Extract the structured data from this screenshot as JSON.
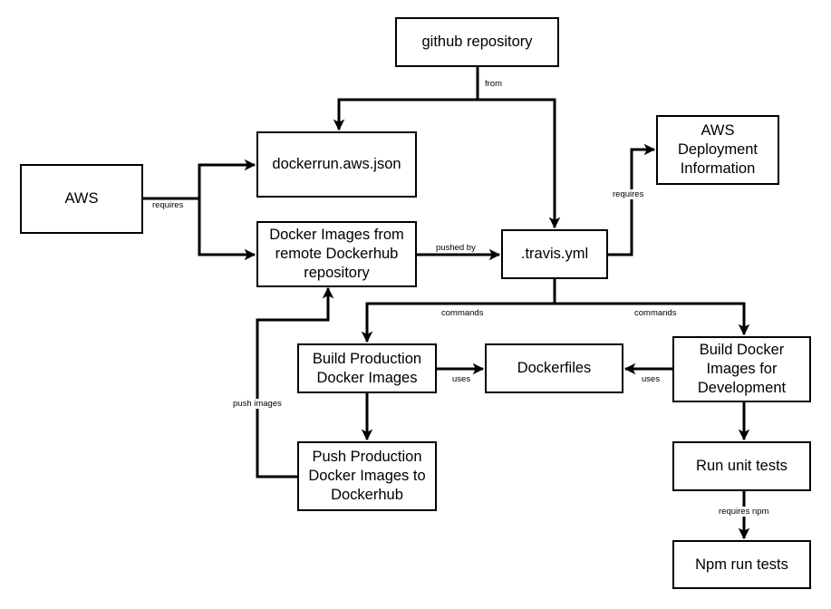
{
  "nodes": {
    "github": "github repository",
    "dockerrun": "dockerrun.aws.json",
    "aws": "AWS",
    "docker_images_remote": "Docker Images from remote Dockerhub repository",
    "travis": ".travis.yml",
    "aws_deploy": "AWS Deployment Information",
    "build_prod": "Build Production Docker Images",
    "dockerfiles": "Dockerfiles",
    "push_prod": "Push Production Docker Images to Dockerhub",
    "build_dev": "Build Docker Images for Development",
    "run_unit": "Run unit tests",
    "npm_run": "Npm run tests"
  },
  "edges": {
    "from": "from",
    "requires_aws": "requires",
    "pushed_by": "pushed by",
    "requires_deploy": "requires",
    "commands_prod": "commands",
    "commands_dev": "commands",
    "uses_prod": "uses",
    "uses_dev": "uses",
    "push_images": "push images",
    "requires_npm": "requires npm"
  }
}
